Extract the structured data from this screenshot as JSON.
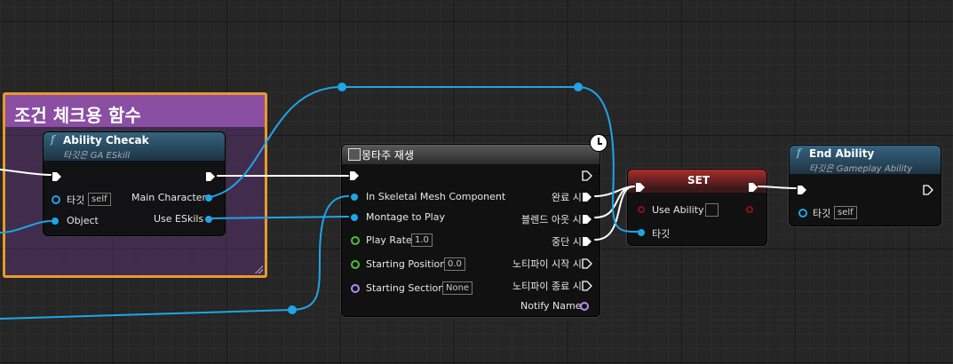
{
  "comment": {
    "title": "조건 체크용 함수"
  },
  "ability_check": {
    "title": "Ability Checak",
    "subtitle": "타깃은 GA ESkill",
    "target_label": "타깃",
    "target_value": "self",
    "object_label": "Object",
    "main_character_label": "Main Character",
    "use_eskils_label": "Use ESkils"
  },
  "montage": {
    "title": "몽타주 재생",
    "skeletal_label": "In Skeletal Mesh Component",
    "montage_label": "Montage to Play",
    "play_rate_label": "Play Rate",
    "play_rate_value": "1.0",
    "start_pos_label": "Starting Position",
    "start_pos_value": "0.0",
    "start_section_label": "Starting Section",
    "start_section_value": "None",
    "complete_label": "완료 시",
    "blend_out_label": "블렌드 아웃 시",
    "interrupt_label": "중단 시",
    "notify_begin_label": "노티파이 시작 시",
    "notify_end_label": "노티파이 종료 시",
    "notify_name_label": "Notify Name"
  },
  "set_node": {
    "title": "SET",
    "use_ability_label": "Use Ability",
    "target_label": "타깃"
  },
  "end_ability": {
    "title": "End Ability",
    "subtitle": "타깃은 Gameplay Ability",
    "target_label": "타깃",
    "target_value": "self"
  },
  "colors": {
    "exec": "#ffffff",
    "object_pin": "#1fa5e8",
    "float_pin": "#4bc43b",
    "name_pin": "#b58cf0",
    "bool_pin": "#8a1212",
    "comment_border": "#e89a2c",
    "comment_header": "#8a4ea3"
  }
}
